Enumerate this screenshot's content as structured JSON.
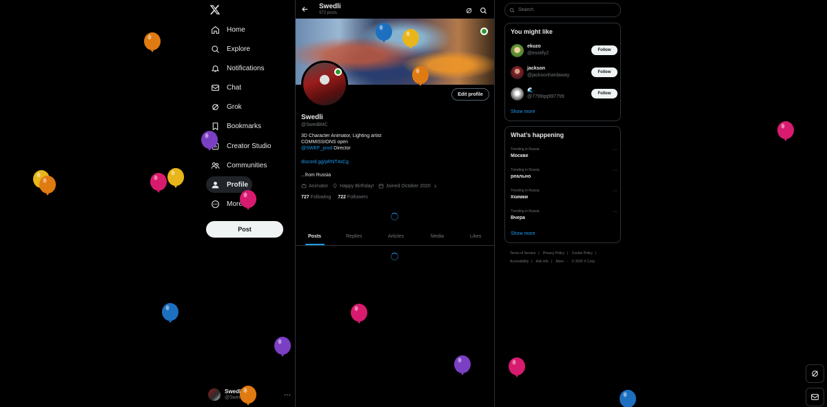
{
  "nav": {
    "items": [
      {
        "label": "Home",
        "icon": "home-icon"
      },
      {
        "label": "Explore",
        "icon": "search-icon"
      },
      {
        "label": "Notifications",
        "icon": "bell-icon"
      },
      {
        "label": "Chat",
        "icon": "mail-icon"
      },
      {
        "label": "Grok",
        "icon": "grok-icon"
      },
      {
        "label": "Bookmarks",
        "icon": "bookmark-icon"
      },
      {
        "label": "Creator Studio",
        "icon": "studio-icon"
      },
      {
        "label": "Communities",
        "icon": "people-icon"
      },
      {
        "label": "Profile",
        "icon": "person-icon"
      },
      {
        "label": "More",
        "icon": "more-circle-icon"
      }
    ],
    "post_label": "Post",
    "account": {
      "name": "Swedli",
      "handle": "@SwedliMC",
      "more": "···"
    }
  },
  "header": {
    "title": "Swedli",
    "subtitle": "972 posts"
  },
  "profile": {
    "edit_label": "Edit profile",
    "name": "Swedli",
    "handle": "@SwedliMC",
    "bio_line1": "3D Character Animator, Lighting artist",
    "bio_line2": "COMMISSIONS open",
    "bio_mention": "@SWEF_prod",
    "bio_mention_suffix": " Director",
    "link": "discord.gg/pRNT4sCg",
    "location": "...from Russia",
    "meta": {
      "job": "Animator",
      "birthday": "Happy Birthday!",
      "joined": "Joined October 2020"
    },
    "following_count": "727",
    "following_label": "Following",
    "followers_count": "722",
    "followers_label": "Followers"
  },
  "tabs": [
    "Posts",
    "Replies",
    "Articles",
    "Media",
    "Likes"
  ],
  "search": {
    "placeholder": "Search"
  },
  "you_might_like": {
    "title": "You might like",
    "users": [
      {
        "name": "ekuzo",
        "handle": "@exotify2",
        "button": "Follow"
      },
      {
        "name": "jackson",
        "handle": "@jacksonhardaway",
        "button": "Follow"
      },
      {
        "name": "🌊",
        "handle": "@7799qq997799",
        "button": "Follow"
      }
    ],
    "show_more": "Show more"
  },
  "whats_happening": {
    "title": "What’s happening",
    "trends": [
      {
        "context": "Trending in Russia",
        "topic": "Москве"
      },
      {
        "context": "Trending in Russia",
        "topic": "реально"
      },
      {
        "context": "Trending in Russia",
        "topic": "#химки"
      },
      {
        "context": "Trending in Russia",
        "topic": "Вчера"
      }
    ],
    "show_more": "Show more"
  },
  "footer": {
    "links": [
      "Terms of Service",
      "|",
      "Privacy Policy",
      "|",
      "Cookie Policy",
      "|",
      "Accessibility",
      "|",
      "Ads info",
      "|",
      "More ···",
      "© 2026 X Corp."
    ]
  },
  "colors": {
    "accent": "#1d9bf0",
    "background": "#000000",
    "border": "#2f3336",
    "muted": "#71767b"
  },
  "balloons": [
    "#e07b12",
    "#7b3fc4",
    "#e8b61a",
    "#d81b6e",
    "#1d6fc0"
  ]
}
